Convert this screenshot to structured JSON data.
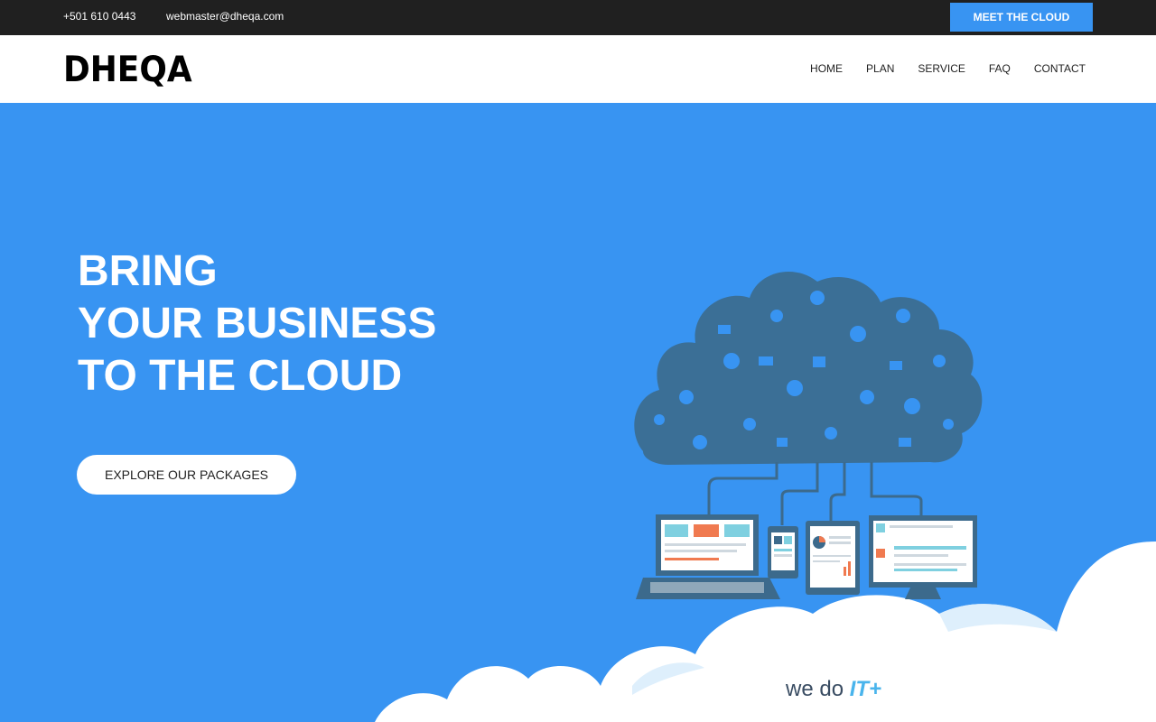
{
  "topbar": {
    "phone": "+501 610 0443",
    "email": "webmaster@dheqa.com",
    "cta_label": "MEET THE CLOUD"
  },
  "header": {
    "logo": "DHEQA",
    "nav": [
      "HOME",
      "PLAN",
      "SERVICE",
      "FAQ",
      "CONTACT"
    ]
  },
  "hero": {
    "title_lines": [
      "BRING",
      "YOUR BUSINESS",
      "TO THE CLOUD"
    ],
    "button_label": "EXPLORE OUR PACKAGES",
    "tagline_prefix": "we do",
    "tagline_emphasis": "IT+"
  },
  "colors": {
    "accent": "#3894f2",
    "topbar": "#202020",
    "cloud_icons": "#3c6a8c",
    "tagline_emphasis": "#49b4ec"
  }
}
